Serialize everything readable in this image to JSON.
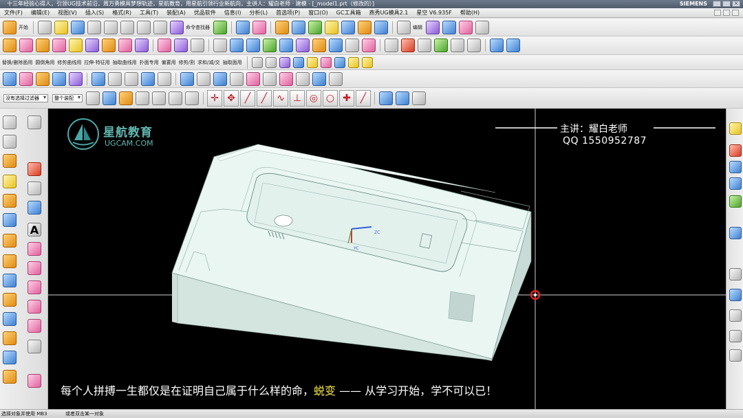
{
  "window": {
    "title": "十三年经验心得人，引领UG技术前沿，周万勇模具梦想轨迹，星航教育，用星航引领行业新航向，主讲人：耀白老师 · 建模 - [_model1.prt（修改的）]",
    "brand": "SIEMENS"
  },
  "menu": {
    "items": [
      "文件(F)",
      "编辑(E)",
      "视图(V)",
      "插入(S)",
      "格式(R)",
      "工具(T)",
      "装配(A)",
      "优品软件",
      "信息(I)",
      "分析(L)",
      "首选项(P)",
      "窗口(O)",
      "GC工具箱",
      "燕秀UG模具2.1",
      "星空 V6.935F",
      "帮助(H)"
    ]
  },
  "toolbar": {
    "start_label": "开始",
    "command_finder_label": "命令查找器",
    "edit_label": "编辑",
    "row3_labels": [
      "替换/删除面用",
      "圆倒角用",
      "修剪曲线用",
      "拉伸·特征用",
      "抽取曲线用",
      "扑面专用",
      "偏置用",
      "修剪/割",
      "求和/减/交",
      "抽取面用"
    ],
    "filter_value": "没有选择过滤器",
    "assembly_value": "整个装配"
  },
  "viewport": {
    "logo_title": "星航教育",
    "logo_subtitle": "UGCAM.COM",
    "lecturer": "主讲：耀白老师",
    "qq": "QQ 1550952787",
    "subtitle_before": "每个人拼搏一生都仅是在证明自己属于什么样的命，",
    "subtitle_highlight": "蜕变",
    "subtitle_after": " —— 从学习开始，学不可以已！",
    "axis_zc": "ZC",
    "axis_yc": "YC"
  },
  "status": {
    "left": "选择对象并使用 MB3",
    "right": "或者双击某一对象"
  },
  "colors": {
    "viewport_bg": "#000000",
    "part_top": "#e8f5f1",
    "part_side": "#d4e4df",
    "highlight": "#f2e240",
    "logo": "#62b6b0"
  }
}
